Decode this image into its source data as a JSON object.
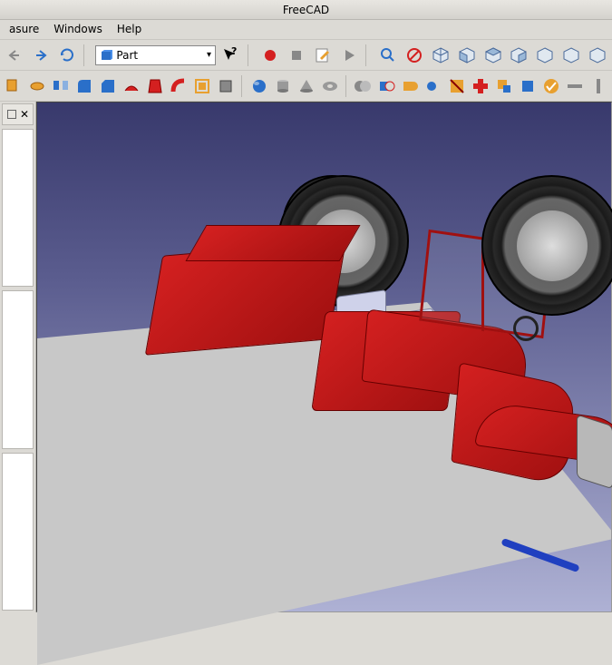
{
  "app": {
    "title": "FreeCAD"
  },
  "menu": {
    "items": [
      "asure",
      "Windows",
      "Help"
    ]
  },
  "workbench": {
    "selected": "Part"
  },
  "colors": {
    "jeep_body": "#c41818",
    "accent_blue": "#2040c0"
  }
}
